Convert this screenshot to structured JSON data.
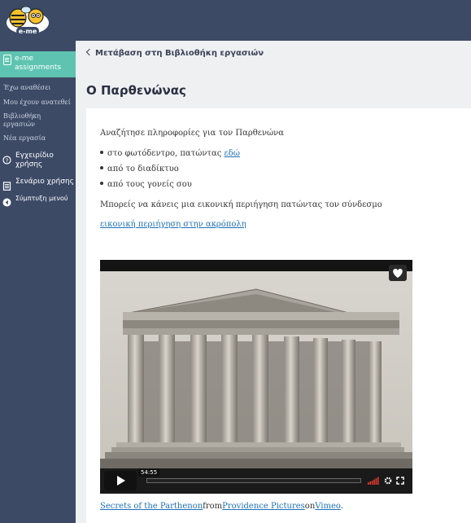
{
  "app": {
    "logo_text": "e-me"
  },
  "sidebar": {
    "active": {
      "label": "e-me assignments"
    },
    "sub_items": [
      {
        "label": "Έχω αναθέσει"
      },
      {
        "label": "Μου έχουν ανατεθεί"
      },
      {
        "label": "Βιβλιοθήκη εργασιών"
      },
      {
        "label": "Νέα εργασία"
      }
    ],
    "items": [
      {
        "label": "Εγχειρίδιο χρήσης",
        "icon": "help-icon"
      },
      {
        "label": "Σενάριο χρήσης",
        "icon": "document-icon"
      },
      {
        "label": "Σύμπτυξη μενού",
        "icon": "collapse-icon"
      }
    ]
  },
  "main": {
    "back_link": "Μετάβαση στη Βιβλιοθήκη εργασιών",
    "title": "Ο Παρθενώνας",
    "intro": "Αναζήτησε πληροφορίες για τον Παρθενώνα",
    "bullets": {
      "b1_text": "στο φωτόδεντρο, πατώντας ",
      "b1_link": "εδώ",
      "b2": "από το διαδίκτυο",
      "b3": "από τους γονείς σου"
    },
    "tour_text": "Μπορείς να κάνεις μια εικονική περιήγηση πατώντας τον σύνδεσμο",
    "tour_link": "εικονική περιήγηση στην ακρόπολη",
    "video": {
      "time": "54:55",
      "credit_title": "Secrets of the Parthenon",
      "from": "from",
      "author": "Providence Pictures",
      "on": "on",
      "platform": "Vimeo",
      "end": "."
    }
  },
  "colors": {
    "topbar": "#3c4a66",
    "active_accent": "#5ec4b1",
    "link": "#1d6fb8"
  }
}
